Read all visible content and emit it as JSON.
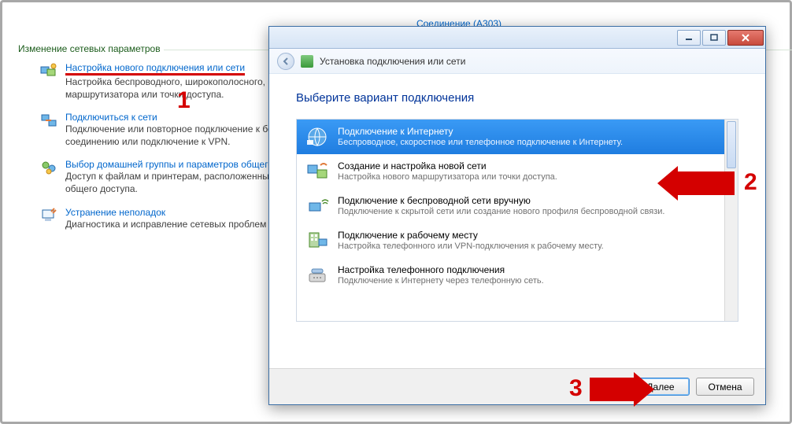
{
  "bg": {
    "top_link": "Соединение (A303)",
    "section_header": "Изменение сетевых параметров",
    "items": [
      {
        "link": "Настройка нового подключения или сети",
        "desc": "Настройка беспроводного, широкополосного, модемного, прямого или VPN-подключения или же настройка маршрутизатора или точки доступа."
      },
      {
        "link": "Подключиться к сети",
        "desc": "Подключение или повторное подключение к беспроводному, проводному, модемному или VPN-сетевому соединению или подключение к VPN."
      },
      {
        "link": "Выбор домашней группы и параметров общего доступа",
        "desc": "Доступ к файлам и принтерам, расположенным на других сетевых компьютерах, или изменение параметров общего доступа."
      },
      {
        "link": "Устранение неполадок",
        "desc": "Диагностика и исправление сетевых проблем или получение сведений об исправлении."
      }
    ]
  },
  "dialog": {
    "header_title": "Установка подключения или сети",
    "heading": "Выберите вариант подключения",
    "options": [
      {
        "title": "Подключение к Интернету",
        "desc": "Беспроводное, скоростное или телефонное подключение к Интернету."
      },
      {
        "title": "Создание и настройка новой сети",
        "desc": "Настройка нового маршрутизатора или точки доступа."
      },
      {
        "title": "Подключение к беспроводной сети вручную",
        "desc": "Подключение к скрытой сети или создание нового профиля беспроводной связи."
      },
      {
        "title": "Подключение к рабочему месту",
        "desc": "Настройка телефонного или VPN-подключения к рабочему месту."
      },
      {
        "title": "Настройка телефонного подключения",
        "desc": "Подключение к Интернету через телефонную сеть."
      }
    ],
    "btn_next": "Далее",
    "btn_cancel": "Отмена"
  },
  "annotations": {
    "n1": "1",
    "n2": "2",
    "n3": "3"
  }
}
